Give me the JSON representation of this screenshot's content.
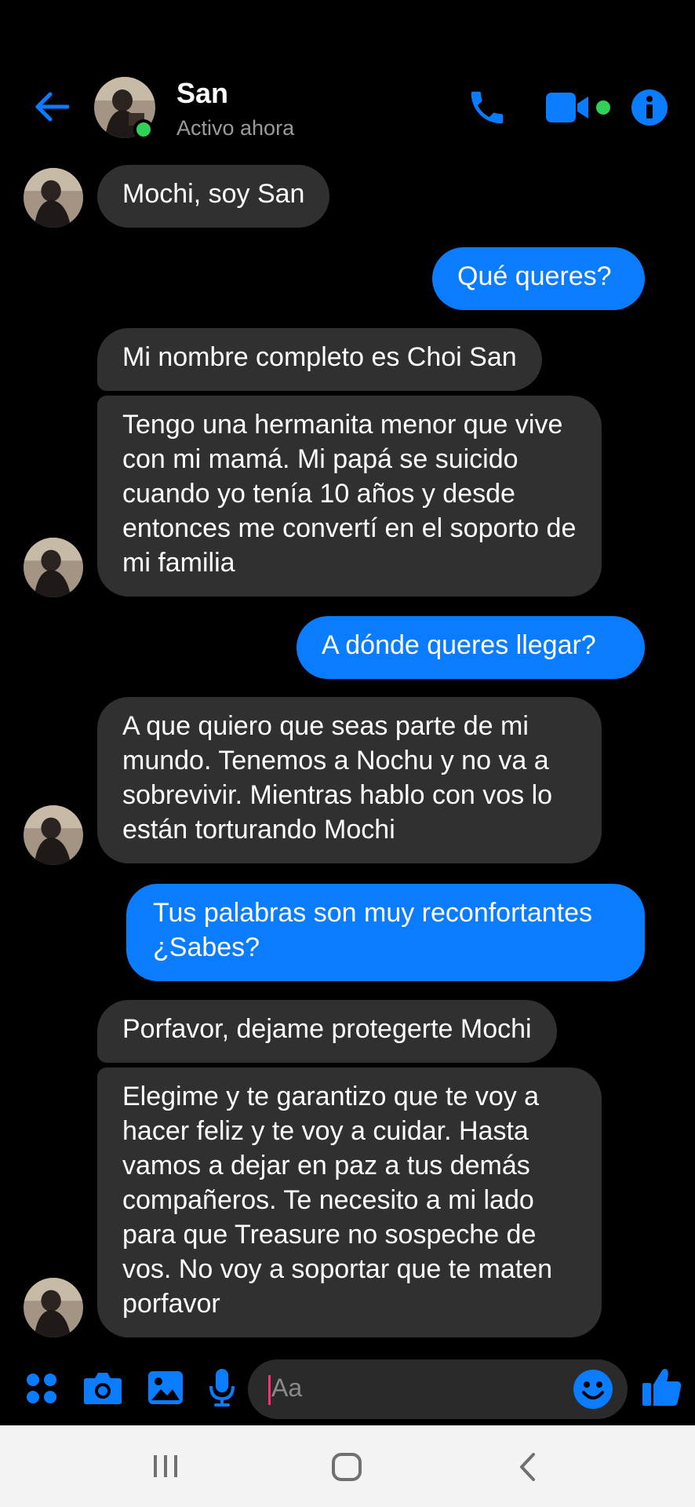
{
  "header": {
    "name": "San",
    "status": "Activo ahora"
  },
  "messages": [
    {
      "from": "them",
      "text": "Mochi, soy San"
    },
    {
      "from": "me",
      "text": "Qué queres?"
    },
    {
      "from": "them",
      "text": "Mi nombre completo es Choi San"
    },
    {
      "from": "them",
      "text": "Tengo una hermanita menor que vive con mi mamá. Mi papá se suicido cuando yo tenía 10 años y desde entonces me convertí en el soporto de mi familia"
    },
    {
      "from": "me",
      "text": "A dónde queres llegar?"
    },
    {
      "from": "them",
      "text": "A que quiero que seas parte de mi mundo. Tenemos a Nochu y no va a sobrevivir. Mientras hablo con vos lo están torturando Mochi"
    },
    {
      "from": "me",
      "text": "Tus palabras son muy reconfortantes ¿Sabes?"
    },
    {
      "from": "them",
      "text": "Porfavor, dejame protegerte Mochi"
    },
    {
      "from": "them",
      "text": "Elegime y te garantizo que te voy a hacer feliz y te voy a cuidar. Hasta vamos a dejar en paz a tus demás compañeros. Te necesito a mi lado para que Treasure no sospeche de vos. No voy a soportar que te maten porfavor"
    }
  ],
  "composer": {
    "placeholder": "Aa"
  },
  "colors": {
    "accent": "#0a7cff",
    "incoming_bubble": "#303030",
    "online": "#31d158",
    "background": "#000000"
  },
  "icons": [
    "back-arrow-icon",
    "phone-icon",
    "video-camera-icon",
    "info-icon",
    "apps-grid-icon",
    "camera-icon",
    "image-icon",
    "microphone-icon",
    "emoji-icon",
    "thumbs-up-icon",
    "recent-apps-icon",
    "home-icon",
    "nav-back-icon"
  ]
}
